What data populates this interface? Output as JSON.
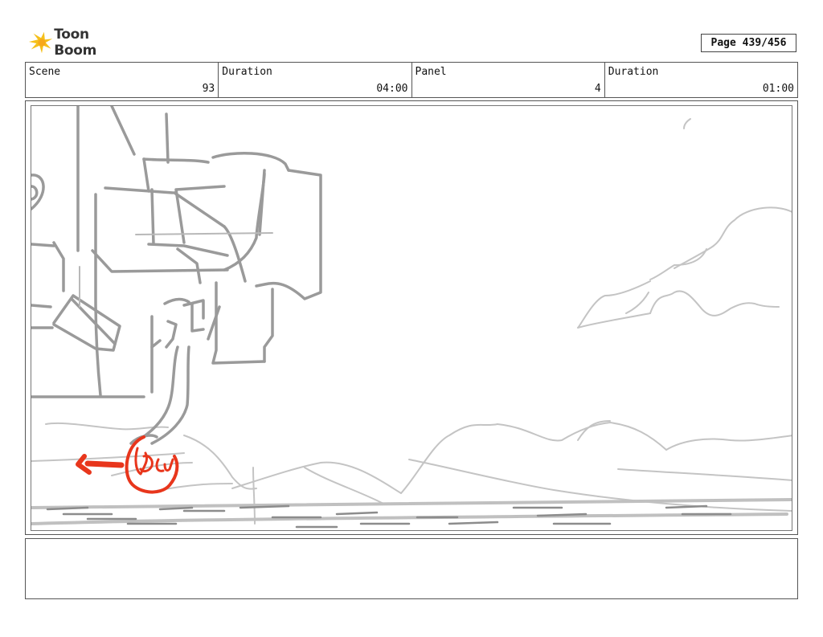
{
  "header": {
    "logo_text": "Toon Boom",
    "page_label": "Page 439/456"
  },
  "info": {
    "scene_label": "Scene",
    "scene_value": "93",
    "scene_duration_label": "Duration",
    "scene_duration_value": "04:00",
    "panel_label": "Panel",
    "panel_value": "4",
    "panel_duration_label": "Duration",
    "panel_duration_value": "01:00"
  },
  "colors": {
    "sketch_gray": "#9a9a9a",
    "light_gray": "#c4c4c4",
    "annotation_red": "#e8361c",
    "logo_yellow": "#f5c01b"
  },
  "notes": {
    "text": ""
  }
}
